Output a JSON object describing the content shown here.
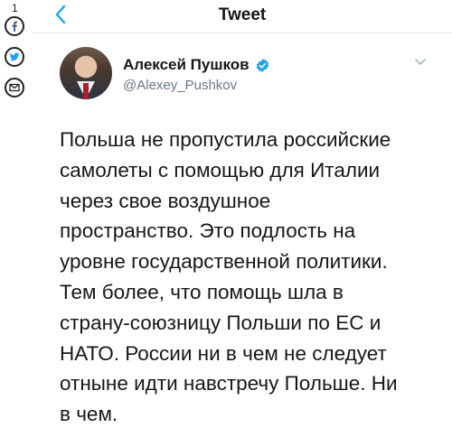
{
  "share": {
    "count": "1",
    "buttons": [
      {
        "name": "facebook",
        "glyph": "f",
        "color": "#3b5998"
      },
      {
        "name": "twitter",
        "glyph": "bird",
        "color": "#1da1f2"
      },
      {
        "name": "email",
        "glyph": "envelope",
        "color": "#222222"
      }
    ]
  },
  "header": {
    "title": "Tweet",
    "back_icon": "chevron-left-icon"
  },
  "author": {
    "display_name": "Алексей Пушков",
    "handle": "@Alexey_Pushkov",
    "verified": true,
    "avatar_icon": "avatar"
  },
  "tweet": {
    "text": "Польша не пропустила российские\nсамолеты с помощью для Италии\nчерез свое воздушное\nпространство. Это подлость на\nуровне государственной политики.\nТем более, что помощь шла в\nстрану-союзницу Польши по ЕС и\nНАТО. России ни в чем не следует\nотныне идти навстречу Польше. Ни\nв чем."
  },
  "colors": {
    "accent": "#1da1f2",
    "text": "#14171a",
    "secondary": "#657786"
  }
}
